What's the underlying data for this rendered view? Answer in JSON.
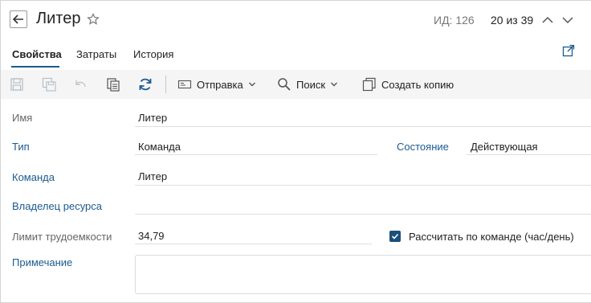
{
  "header": {
    "title": "Литер",
    "id_label": "ИД: 126",
    "pager": "20 из 39"
  },
  "tabs": [
    {
      "label": "Свойства",
      "active": true
    },
    {
      "label": "Затраты",
      "active": false
    },
    {
      "label": "История",
      "active": false
    }
  ],
  "toolbar": {
    "send_label": "Отправка",
    "search_label": "Поиск",
    "copy_label": "Создать копию"
  },
  "form": {
    "name_label": "Имя",
    "name_value": "Литер",
    "type_label": "Тип",
    "type_value": "Команда",
    "state_label": "Состояние",
    "state_value": "Действующая",
    "team_label": "Команда",
    "team_value": "Литер",
    "owner_label": "Владелец ресурса",
    "owner_value": "",
    "limit_label": "Лимит трудоемкости",
    "limit_value": "34,79",
    "calc_label": "Рассчитать по команде (час/день)",
    "calc_checked": true,
    "note_label": "Примечание",
    "note_value": ""
  },
  "colors": {
    "accent": "#1b5a8f",
    "checkbox": "#1b4f7a",
    "toolbar_bg": "#f5f5f5"
  }
}
